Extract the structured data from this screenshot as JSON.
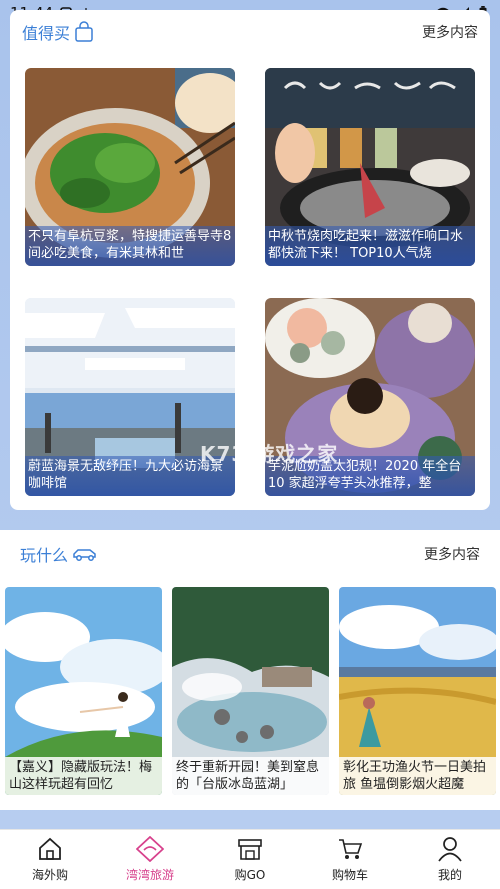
{
  "status_bar": {
    "time": "11:44",
    "left_icons": [
      "notification-icon",
      "signal-small-icon"
    ],
    "right_icons": [
      "wifi-icon",
      "cell-signal-icon",
      "battery-icon"
    ]
  },
  "worth_buying": {
    "title": "值得买",
    "title_icon": "shopping-bag-icon",
    "more": "更多内容",
    "tiles": [
      {
        "caption": "不只有阜杭豆浆，特搜捷运善导寺8间必吃美食，有米其林和世"
      },
      {
        "caption": "中秋节烧肉吃起来！滋滋作响口水都快流下来！ TOP10人气烧"
      },
      {
        "caption": "蔚蓝海景无敌纾压！九大必访海景咖啡馆"
      },
      {
        "caption": "芋泥尬奶盖太犯规！2020 年全台 10 家超浮夸芋头冰推荐，整"
      }
    ]
  },
  "watermark": "K73 游戏之家",
  "things_to_do": {
    "title": "玩什么",
    "title_icon": "car-icon",
    "more": "更多内容",
    "tiles": [
      {
        "caption": "【嘉义】隐藏版玩法！梅山这样玩超有回忆"
      },
      {
        "caption": "终于重新开园！美到窒息的「台版冰岛蓝湖」"
      },
      {
        "caption": "彰化王功渔火节一日美拍旅 鱼塭倒影烟火超魔"
      }
    ]
  },
  "bottom_nav": [
    {
      "label": "海外购",
      "icon": "home-icon",
      "active": false
    },
    {
      "label": "湾湾旅游",
      "icon": "travel-diamond-icon",
      "active": true
    },
    {
      "label": "购GO",
      "icon": "store-icon",
      "active": false
    },
    {
      "label": "购物车",
      "icon": "cart-icon",
      "active": false
    },
    {
      "label": "我的",
      "icon": "user-icon",
      "active": false
    }
  ],
  "colors": {
    "accent_blue": "#3b7fd6",
    "active_pink": "#d7418c",
    "background": "#a9c3ec"
  }
}
